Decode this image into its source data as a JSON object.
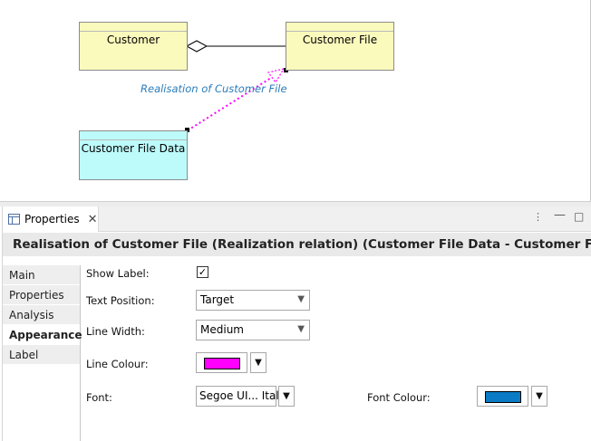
{
  "diagram": {
    "elements": {
      "customer": "Customer",
      "customer_file": "Customer File",
      "customer_file_data": "Customer File Data"
    },
    "connection_label": "Realisation of Customer File",
    "colors": {
      "business_object": "#fafabd",
      "data_object": "#bdfafa",
      "realization_line": "#ff00ff",
      "label_text": "#2a7cba"
    }
  },
  "properties_view": {
    "tab_label": "Properties",
    "title": "Realisation of Customer File (Realization relation) (Customer File Data - Customer File)",
    "sections": [
      "Main",
      "Properties",
      "Analysis",
      "Appearance",
      "Label"
    ],
    "active_section": "Appearance",
    "form": {
      "show_label": {
        "label": "Show Label:",
        "checked": true
      },
      "text_position": {
        "label": "Text Position:",
        "value": "Target"
      },
      "line_width": {
        "label": "Line Width:",
        "value": "Medium"
      },
      "line_colour": {
        "label": "Line Colour:",
        "color": "#ff00ff"
      },
      "font": {
        "label": "Font:",
        "value": "Segoe UI... Italic"
      },
      "font_colour": {
        "label": "Font Colour:",
        "color": "#0a7bc4"
      }
    }
  }
}
